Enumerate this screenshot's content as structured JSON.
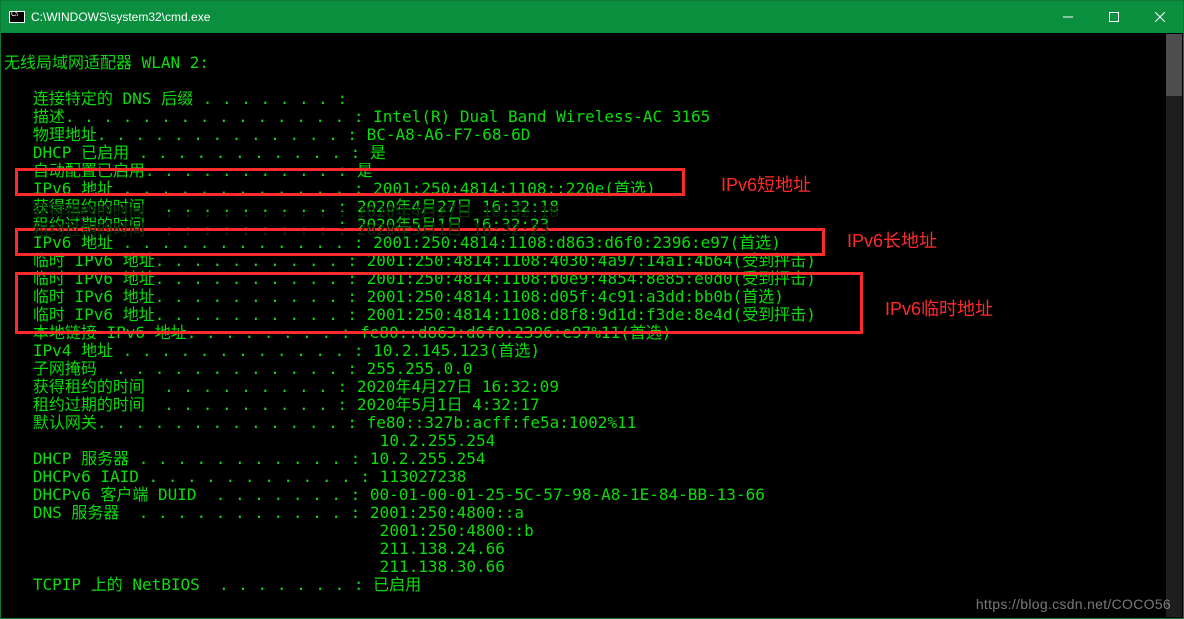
{
  "title": "C:\\WINDOWS\\system32\\cmd.exe",
  "adapter_header": "无线局域网适配器 WLAN 2:",
  "lines": {
    "l1": "   连接特定的 DNS 后缀 . . . . . . . :",
    "l2": "   描述. . . . . . . . . . . . . . . : Intel(R) Dual Band Wireless-AC 3165",
    "l3": "   物理地址. . . . . . . . . . . . . : BC-A8-A6-F7-68-6D",
    "l4": "   DHCP 已启用 . . . . . . . . . . . : 是",
    "l5": "   自动配置已启用. . . . . . . . . . : 是",
    "l6": "   IPv6 地址 . . . . . . . . . . . . : 2001:250:4814:1108::220e(首选)",
    "l7": "   获得租约的时间  . . . . . . . . . : 2020年4月27日 16:32:18",
    "l8": "   租约过期的时间  . . . . . . . . . : 2020年5月1日 16:32:23",
    "l9": "   IPv6 地址 . . . . . . . . . . . . : 2001:250:4814:1108:d863:d6f0:2396:e97(首选)",
    "l10": "   临时 IPv6 地址. . . . . . . . . . : 2001:250:4814:1108:4030:4a97:14a1:4b64(受到抨击)",
    "l11": "   临时 IPv6 地址. . . . . . . . . . : 2001:250:4814:1108:b0e9:4854:8e85:e0d0(受到抨击)",
    "l12": "   临时 IPv6 地址. . . . . . . . . . : 2001:250:4814:1108:d05f:4c91:a3dd:bb0b(首选)",
    "l13": "   临时 IPv6 地址. . . . . . . . . . : 2001:250:4814:1108:d8f8:9d1d:f3de:8e4d(受到抨击)",
    "l14": "   本地链接 IPv6 地址. . . . . . . . : fe80::d863:d6f0:2396:e97%11(首选)",
    "l15": "   IPv4 地址 . . . . . . . . . . . . : 10.2.145.123(首选)",
    "l16": "   子网掩码  . . . . . . . . . . . . : 255.255.0.0",
    "l17": "   获得租约的时间  . . . . . . . . . : 2020年4月27日 16:32:09",
    "l18": "   租约过期的时间  . . . . . . . . . : 2020年5月1日 4:32:17",
    "l19": "   默认网关. . . . . . . . . . . . . : fe80::327b:acff:fe5a:1002%11",
    "l20": "                                       10.2.255.254",
    "l21": "   DHCP 服务器 . . . . . . . . . . . : 10.2.255.254",
    "l22": "   DHCPv6 IAID . . . . . . . . . . . : 113027238",
    "l23": "   DHCPv6 客户端 DUID  . . . . . . . : 00-01-00-01-25-5C-57-98-A8-1E-84-BB-13-66",
    "l24": "   DNS 服务器  . . . . . . . . . . . : 2001:250:4800::a",
    "l25": "                                       2001:250:4800::b",
    "l26": "                                       211.138.24.66",
    "l27": "                                       211.138.30.66",
    "l28": "   TCPIP 上的 NetBIOS  . . . . . . . : 已启用"
  },
  "annotations": {
    "short": "IPv6短地址",
    "long": "IPv6长地址",
    "temp": "IPv6临时地址"
  },
  "watermark": "https://blog.csdn.net/COCO56"
}
